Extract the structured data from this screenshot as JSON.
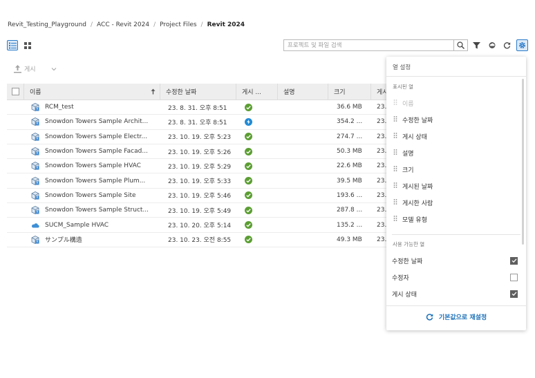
{
  "breadcrumb": {
    "items": [
      "Revit_Testing_Playground",
      "ACC - Revit 2024",
      "Project Files"
    ],
    "current": "Revit 2024",
    "separator": "/"
  },
  "toolbar": {
    "publish_label": "게시",
    "search_placeholder": "프로젝트 및 파일 검색",
    "icons": [
      "list-view-icon",
      "grid-view-icon",
      "search-icon",
      "filter-icon",
      "cloud-icon",
      "refresh-icon",
      "settings-icon"
    ]
  },
  "table": {
    "headers": {
      "name": "이름",
      "modified": "수정한 날짜",
      "status": "게시 ...",
      "description": "설명",
      "size": "크기",
      "more": "게시"
    },
    "rows": [
      {
        "name": "RCM_test",
        "modified": "23. 8. 31. 오후 8:51",
        "status": "ok",
        "size": "36.6 MB",
        "more": "23.",
        "icon": "revit-model-icon"
      },
      {
        "name": "Snowdon Towers Sample Archit...",
        "modified": "23. 8. 31. 오후 8:51",
        "status": "processing",
        "size": "354.2 ...",
        "more": "23.",
        "icon": "revit-model-icon"
      },
      {
        "name": "Snowdon Towers Sample Electr...",
        "modified": "23. 10. 19. 오후 5:23",
        "status": "ok",
        "size": "274.7 ...",
        "more": "23.",
        "icon": "revit-model-icon"
      },
      {
        "name": "Snowdon Towers Sample Facad...",
        "modified": "23. 10. 19. 오후 5:26",
        "status": "ok",
        "size": "50.3 MB",
        "more": "23.",
        "icon": "revit-model-icon"
      },
      {
        "name": "Snowdon Towers Sample HVAC",
        "modified": "23. 10. 19. 오후 5:29",
        "status": "ok",
        "size": "22.6 MB",
        "more": "23.",
        "icon": "revit-model-icon"
      },
      {
        "name": "Snowdon Towers Sample Plum...",
        "modified": "23. 10. 19. 오후 5:33",
        "status": "ok",
        "size": "39.5 MB",
        "more": "23.",
        "icon": "revit-model-icon"
      },
      {
        "name": "Snowdon Towers Sample Site",
        "modified": "23. 10. 19. 오후 5:46",
        "status": "ok",
        "size": "193.6 ...",
        "more": "23.",
        "icon": "revit-model-icon"
      },
      {
        "name": "Snowdon Towers Sample Struct...",
        "modified": "23. 10. 19. 오후 5:49",
        "status": "ok",
        "size": "287.8 ...",
        "more": "23.",
        "icon": "revit-model-icon"
      },
      {
        "name": "SUCM_Sample HVAC",
        "modified": "23. 10. 20. 오후 5:14",
        "status": "ok",
        "size": "135.2 ...",
        "more": "23.",
        "icon": "cloud-model-icon"
      },
      {
        "name": "サンプル構造",
        "modified": "23. 10. 23. 오전 8:55",
        "status": "ok",
        "size": "49.3 MB",
        "more": "23.",
        "icon": "revit-model-icon"
      }
    ]
  },
  "panel": {
    "title": "열 설정",
    "shown_label": "표시된 열",
    "shown_columns": [
      {
        "label": "이름",
        "disabled": true
      },
      {
        "label": "수정한 날짜",
        "disabled": false
      },
      {
        "label": "게시 상태",
        "disabled": false
      },
      {
        "label": "설명",
        "disabled": false
      },
      {
        "label": "크기",
        "disabled": false
      },
      {
        "label": "게시된 날짜",
        "disabled": false
      },
      {
        "label": "게시한 사람",
        "disabled": false
      },
      {
        "label": "모델 유형",
        "disabled": false
      }
    ],
    "available_label": "사용 가능한 열",
    "available_columns": [
      {
        "label": "수정한 날짜",
        "checked": true
      },
      {
        "label": "수정자",
        "checked": false
      },
      {
        "label": "게시 상태",
        "checked": true
      }
    ],
    "reset_label": "기본값으로 재설정"
  },
  "colors": {
    "accent": "#1a6fb8",
    "status_ok": "#5c9e33",
    "status_processing": "#1f8ad6",
    "header_bg": "#eeeeee"
  }
}
